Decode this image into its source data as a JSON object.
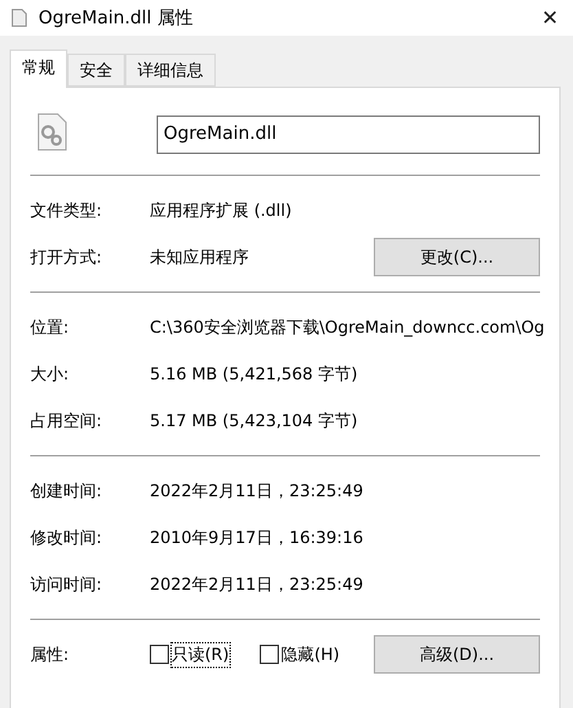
{
  "window": {
    "title": "OgreMain.dll 属性",
    "close": "✕"
  },
  "tabs": [
    {
      "label": "常规",
      "selected": true
    },
    {
      "label": "安全",
      "selected": false
    },
    {
      "label": "详细信息",
      "selected": false
    }
  ],
  "file_name": "OgreMain.dll",
  "sections": [
    {
      "rows": [
        {
          "label": "文件类型:",
          "value": "应用程序扩展 (.dll)"
        },
        {
          "label": "打开方式:",
          "value": "未知应用程序",
          "button": "更改(C)..."
        }
      ]
    },
    {
      "rows": [
        {
          "label": "位置:",
          "value": "C:\\360安全浏览器下载\\OgreMain_downcc.com\\Og"
        },
        {
          "label": "大小:",
          "value": "5.16 MB (5,421,568 字节)"
        },
        {
          "label": "占用空间:",
          "value": "5.17 MB (5,423,104 字节)"
        }
      ]
    },
    {
      "rows": [
        {
          "label": "创建时间:",
          "value": "2022年2月11日，23:25:49"
        },
        {
          "label": "修改时间:",
          "value": "2010年9月17日，16:39:16"
        },
        {
          "label": "访问时间:",
          "value": "2022年2月11日，23:25:49"
        }
      ]
    }
  ],
  "attributes": {
    "label": "属性:",
    "options": [
      {
        "label": "只读(R)",
        "checked": false,
        "focused": true
      },
      {
        "label": "隐藏(H)",
        "checked": false,
        "focused": false
      }
    ],
    "button": "高级(D)..."
  }
}
